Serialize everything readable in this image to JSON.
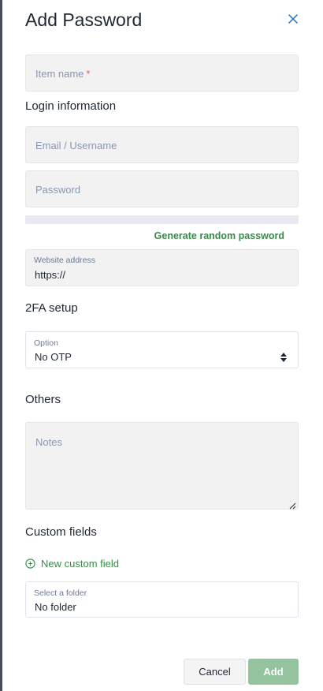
{
  "dialog": {
    "title": "Add Password"
  },
  "item_name": {
    "placeholder": "Item name",
    "required_mark": "*"
  },
  "login": {
    "heading": "Login information",
    "email_placeholder": "Email / Username",
    "password_placeholder": "Password",
    "generate_label": "Generate random password",
    "website": {
      "label": "Website address",
      "value": "https://"
    }
  },
  "twofa": {
    "heading": "2FA setup",
    "option": {
      "label": "Option",
      "value": "No OTP"
    }
  },
  "others": {
    "heading": "Others",
    "notes_placeholder": "Notes"
  },
  "custom": {
    "heading": "Custom fields",
    "new_field_label": "New custom field"
  },
  "folder": {
    "label": "Select a folder",
    "value": "No folder"
  },
  "actions": {
    "cancel": "Cancel",
    "add": "Add"
  },
  "colors": {
    "accent_green": "#3a8a4a",
    "add_button": "#93c49d",
    "close_blue": "#3b7fbf",
    "required_red": "#e25a63"
  },
  "icons": {
    "close": "close-icon",
    "add": "plus-circle-icon",
    "select": "sort-caret-icon",
    "resize": "resize-grip-icon"
  }
}
